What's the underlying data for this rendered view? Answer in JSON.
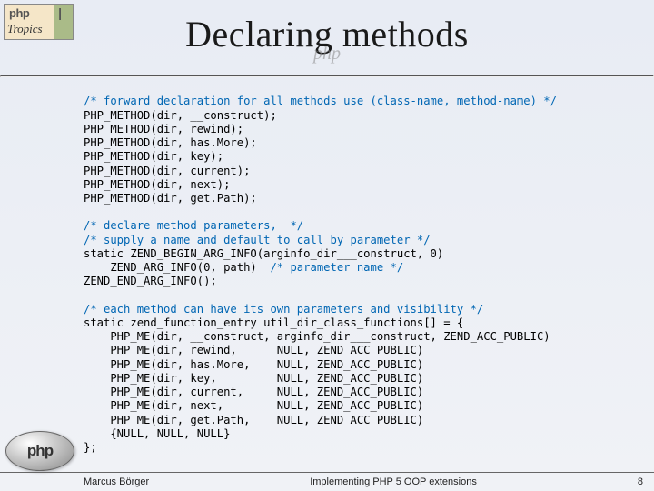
{
  "header": {
    "logo_php": "php",
    "logo_bar": "|",
    "logo_tropics": "Tropics",
    "title": "Declaring methods",
    "watermark": "php"
  },
  "code": {
    "block1_comment": "/* forward declaration for all methods use (class-name, method-name) */",
    "block1_body": "PHP_METHOD(dir, __construct);\nPHP_METHOD(dir, rewind);\nPHP_METHOD(dir, has.More);\nPHP_METHOD(dir, key);\nPHP_METHOD(dir, current);\nPHP_METHOD(dir, next);\nPHP_METHOD(dir, get.Path);",
    "block2_c1": "/* declare method parameters,  */",
    "block2_c2": "/* supply a name and default to call by parameter */",
    "block2_l1": "static ZEND_BEGIN_ARG_INFO(arginfo_dir___construct, 0)",
    "block2_l2a": "    ZEND_ARG_INFO(0, path)  ",
    "block2_l2b": "/* parameter name */",
    "block2_l3": "ZEND_END_ARG_INFO();",
    "block3_comment": "/* each method can have its own parameters and visibility */",
    "block3_body": "static zend_function_entry util_dir_class_functions[] = {\n    PHP_ME(dir, __construct, arginfo_dir___construct, ZEND_ACC_PUBLIC)\n    PHP_ME(dir, rewind,      NULL, ZEND_ACC_PUBLIC)\n    PHP_ME(dir, has.More,    NULL, ZEND_ACC_PUBLIC)\n    PHP_ME(dir, key,         NULL, ZEND_ACC_PUBLIC)\n    PHP_ME(dir, current,     NULL, ZEND_ACC_PUBLIC)\n    PHP_ME(dir, next,        NULL, ZEND_ACC_PUBLIC)\n    PHP_ME(dir, get.Path,    NULL, ZEND_ACC_PUBLIC)\n    {NULL, NULL, NULL}\n};"
  },
  "footer": {
    "author": "Marcus Börger",
    "center": "Implementing PHP 5 OOP extensions",
    "page": "8"
  },
  "bottom_logo": "php"
}
